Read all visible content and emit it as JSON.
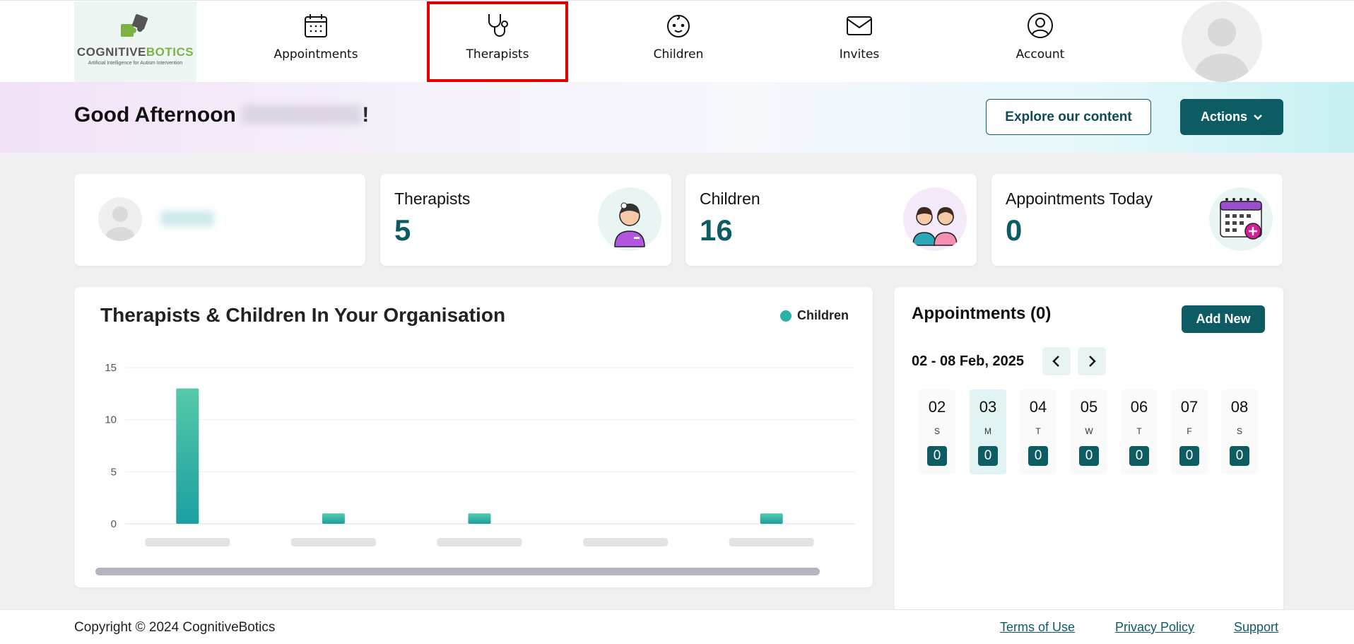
{
  "colors": {
    "brand": "#0d5c63",
    "accent": "#2ab3a6",
    "highlight_outline": "#e00000"
  },
  "logo": {
    "brand_part1": "COGNITIVE",
    "brand_part2": "BOTICS",
    "tagline": "Artificial Intelligence for Autism Intervention"
  },
  "nav": {
    "items": [
      {
        "label": "Appointments",
        "icon": "calendar-icon"
      },
      {
        "label": "Therapists",
        "icon": "stethoscope-icon",
        "active": true
      },
      {
        "label": "Children",
        "icon": "baby-face-icon"
      },
      {
        "label": "Invites",
        "icon": "envelope-icon"
      },
      {
        "label": "Account",
        "icon": "user-circle-icon"
      }
    ]
  },
  "greeting": {
    "prefix": "Good Afternoon ",
    "suffix": "!"
  },
  "header_buttons": {
    "explore": "Explore our content",
    "actions": "Actions"
  },
  "stats": [
    {
      "title": "Therapists",
      "value": "5",
      "icon": "therapist-icon"
    },
    {
      "title": "Children",
      "value": "16",
      "icon": "children-icon"
    },
    {
      "title": "Appointments Today",
      "value": "0",
      "icon": "calendar-add-icon"
    }
  ],
  "chart": {
    "title": "Therapists & Children In Your Organisation",
    "legend": "Children"
  },
  "chart_data": {
    "type": "bar",
    "title": "Therapists & Children In Your Organisation",
    "xlabel": "",
    "ylabel": "",
    "ylim": [
      0,
      15
    ],
    "yticks": [
      0,
      5,
      10,
      15
    ],
    "grid": true,
    "legend_position": "top-right",
    "categories": [
      "",
      "",
      "",
      "",
      ""
    ],
    "series": [
      {
        "name": "Children",
        "values": [
          13,
          1,
          1,
          0,
          1
        ],
        "color": "#2ab3a6"
      }
    ]
  },
  "appointments": {
    "title": "Appointments (0)",
    "add_new": "Add New",
    "range": "02 - 08 Feb, 2025",
    "days": [
      {
        "date": "02",
        "weekday": "S",
        "count": "0"
      },
      {
        "date": "03",
        "weekday": "M",
        "count": "0",
        "selected": true
      },
      {
        "date": "04",
        "weekday": "T",
        "count": "0"
      },
      {
        "date": "05",
        "weekday": "W",
        "count": "0"
      },
      {
        "date": "06",
        "weekday": "T",
        "count": "0"
      },
      {
        "date": "07",
        "weekday": "F",
        "count": "0"
      },
      {
        "date": "08",
        "weekday": "S",
        "count": "0"
      }
    ]
  },
  "footer": {
    "copyright": "Copyright © 2024 CognitiveBotics",
    "terms": "Terms of Use",
    "privacy": "Privacy Policy",
    "support": "Support"
  }
}
